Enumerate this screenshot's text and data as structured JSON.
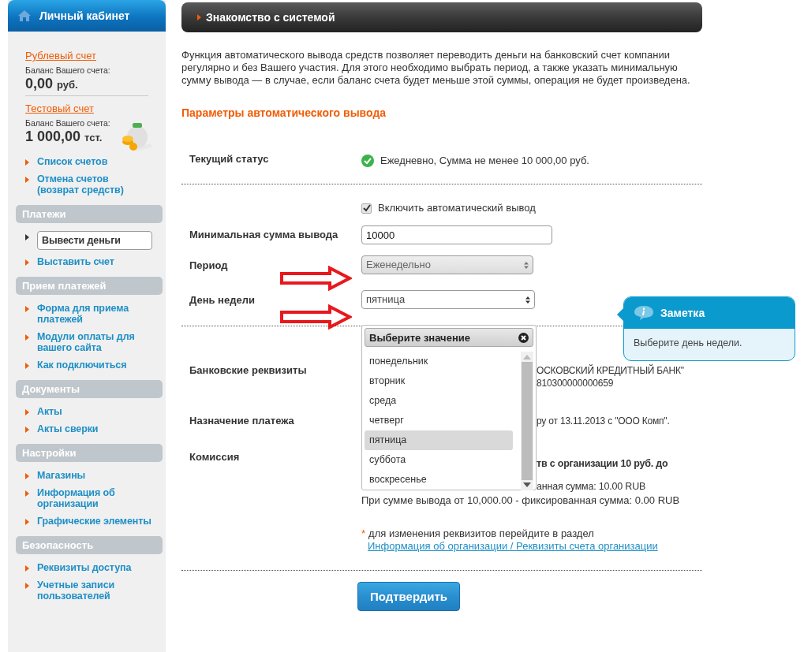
{
  "sidebar": {
    "title": "Личный кабинет",
    "accounts": [
      {
        "name": "Рублевый счет",
        "balance_label": "Баланс Вашего счета:",
        "amount": "0,00",
        "currency": "руб.",
        "icon": false
      },
      {
        "name": "Тестовый счет",
        "balance_label": "Баланс Вашего счета:",
        "amount": "1 000,00",
        "currency": "тст.",
        "icon": true
      }
    ],
    "groups": [
      {
        "items": [
          {
            "label": "Список счетов",
            "selected": false
          },
          {
            "label": "Отмена счетов (возврат средств)",
            "selected": false
          }
        ]
      },
      {
        "title": "Платежи",
        "items": [
          {
            "label": "Вывести деньги",
            "selected": true
          },
          {
            "label": "Выставить счет",
            "selected": false
          }
        ]
      },
      {
        "title": "Прием платежей",
        "items": [
          {
            "label": "Форма для приема платежей",
            "selected": false
          },
          {
            "label": "Модули оплаты для вашего сайта",
            "selected": false
          },
          {
            "label": "Как подключиться",
            "selected": false
          }
        ]
      },
      {
        "title": "Документы",
        "items": [
          {
            "label": "Акты",
            "selected": false
          },
          {
            "label": "Акты сверки",
            "selected": false
          }
        ]
      },
      {
        "title": "Настройки",
        "items": [
          {
            "label": "Магазины",
            "selected": false
          },
          {
            "label": "Информация об организации",
            "selected": false
          },
          {
            "label": "Графические элементы",
            "selected": false
          }
        ]
      },
      {
        "title": "Безопасность",
        "items": [
          {
            "label": "Реквизиты доступа",
            "selected": false
          },
          {
            "label": "Учетные записи пользователей",
            "selected": false
          }
        ]
      }
    ]
  },
  "main": {
    "title": "Знакомство с системой",
    "intro": "Функция автоматического вывода средств позволяет переводить деньги на банковский счет компании регулярно и без Вашего участия. Для этого необходимо выбрать период, а также указать минимальную сумму вывода — в случае, если баланс счета будет меньше этой суммы, операция не будет произведена.",
    "section_title": "Параметры автоматического вывода",
    "status": {
      "label": "Текущий статус",
      "text": "Ежедневно, Сумма не менее 10 000,00 руб."
    },
    "auto_withdraw": {
      "label": "Включить автоматический вывод",
      "checked": true
    },
    "min_amount": {
      "label": "Минимальная сумма вывода",
      "value": "10000"
    },
    "period": {
      "label": "Период",
      "value": "Еженедельно",
      "disabled": true
    },
    "weekday": {
      "label": "День недели",
      "value": "пятница"
    },
    "dropdown": {
      "title": "Выберите значение",
      "options": [
        {
          "label": "понедельник",
          "selected": false
        },
        {
          "label": "вторник",
          "selected": false
        },
        {
          "label": "среда",
          "selected": false
        },
        {
          "label": "четверг",
          "selected": false
        },
        {
          "label": "пятница",
          "selected": true
        },
        {
          "label": "суббота",
          "selected": false
        },
        {
          "label": "воскресенье",
          "selected": false
        }
      ]
    },
    "bank": {
      "label": "Банковские реквизиты",
      "lines": [
        "ОСКОВСКИЙ КРЕДИТНЫЙ БАНК\"",
        "810300000000659"
      ]
    },
    "purpose": {
      "label": "Назначение платежа",
      "lines": [
        "ру от 13.11.2013 с \"ООО Комп\"."
      ]
    },
    "commission": {
      "label": "Комиссия",
      "cut_lines": [
        {
          "text": "тв с организации 10 руб. до",
          "bold": true
        },
        {
          "text": "анная сумма: 10.00 RUB",
          "bold": false
        }
      ],
      "line": "При сумме вывода от 10,000.00 - фиксированная сумма: 0.00 RUB"
    },
    "footnote": {
      "mark": "*",
      "text": "для изменения реквизитов перейдите в раздел",
      "link": "Информация об организации / Реквизиты счета организации"
    },
    "confirm": "Подтвердить"
  },
  "note": {
    "title": "Заметка",
    "text": "Выберите день недели."
  }
}
